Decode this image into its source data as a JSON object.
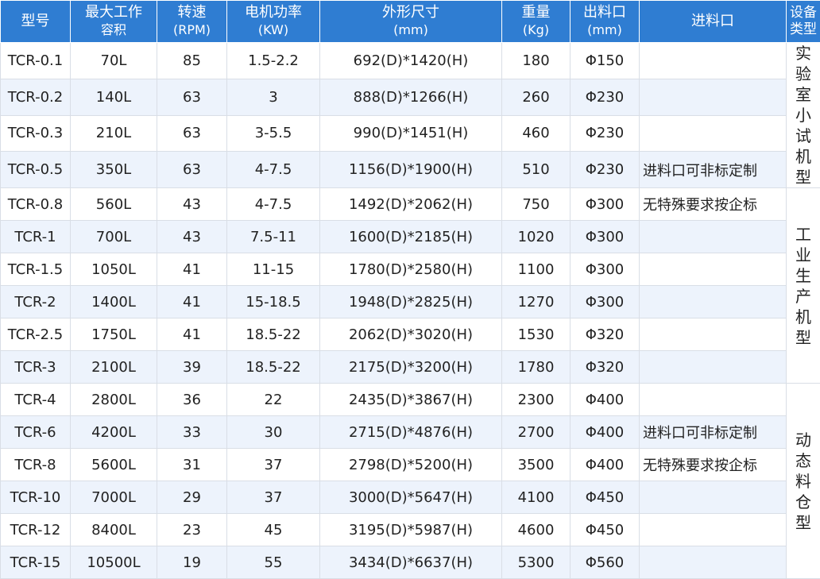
{
  "headers": {
    "model": "型号",
    "capacity_line1": "最大工作",
    "capacity_line2": "容积",
    "speed_line1": "转速",
    "speed_line2": "(RPM)",
    "power_line1": "电机功率",
    "power_line2": "(KW)",
    "dims_line1": "外形尺寸",
    "dims_line2": "(mm)",
    "weight_line1": "重量",
    "weight_line2": "(Kg)",
    "outlet_line1": "出料口",
    "outlet_line2": "(mm)",
    "inlet": "进料口",
    "type_line1": "设备",
    "type_line2": "类型"
  },
  "rows": [
    {
      "model": "TCR-0.1",
      "capacity": "70L",
      "speed": "85",
      "power": "1.5-2.2",
      "dims": "692(D)*1420(H)",
      "weight": "180",
      "outlet": "Φ150",
      "inlet": ""
    },
    {
      "model": "TCR-0.2",
      "capacity": "140L",
      "speed": "63",
      "power": "3",
      "dims": "888(D)*1266(H)",
      "weight": "260",
      "outlet": "Φ230",
      "inlet": ""
    },
    {
      "model": "TCR-0.3",
      "capacity": "210L",
      "speed": "63",
      "power": "3-5.5",
      "dims": "990(D)*1451(H)",
      "weight": "460",
      "outlet": "Φ230",
      "inlet": ""
    },
    {
      "model": "TCR-0.5",
      "capacity": "350L",
      "speed": "63",
      "power": "4-7.5",
      "dims": "1156(D)*1900(H)",
      "weight": "510",
      "outlet": "Φ230",
      "inlet": "进料口可非标定制"
    },
    {
      "model": "TCR-0.8",
      "capacity": "560L",
      "speed": "43",
      "power": "4-7.5",
      "dims": "1492(D)*2062(H)",
      "weight": "750",
      "outlet": "Φ300",
      "inlet": "无特殊要求按企标"
    },
    {
      "model": "TCR-1",
      "capacity": "700L",
      "speed": "43",
      "power": "7.5-11",
      "dims": "1600(D)*2185(H)",
      "weight": "1020",
      "outlet": "Φ300",
      "inlet": ""
    },
    {
      "model": "TCR-1.5",
      "capacity": "1050L",
      "speed": "41",
      "power": "11-15",
      "dims": "1780(D)*2580(H)",
      "weight": "1100",
      "outlet": "Φ300",
      "inlet": ""
    },
    {
      "model": "TCR-2",
      "capacity": "1400L",
      "speed": "41",
      "power": "15-18.5",
      "dims": "1948(D)*2825(H)",
      "weight": "1270",
      "outlet": "Φ300",
      "inlet": ""
    },
    {
      "model": "TCR-2.5",
      "capacity": "1750L",
      "speed": "41",
      "power": "18.5-22",
      "dims": "2062(D)*3020(H)",
      "weight": "1530",
      "outlet": "Φ320",
      "inlet": ""
    },
    {
      "model": "TCR-3",
      "capacity": "2100L",
      "speed": "39",
      "power": "18.5-22",
      "dims": "2175(D)*3200(H)",
      "weight": "1780",
      "outlet": "Φ320",
      "inlet": ""
    },
    {
      "model": "TCR-4",
      "capacity": "2800L",
      "speed": "36",
      "power": "22",
      "dims": "2435(D)*3867(H)",
      "weight": "2300",
      "outlet": "Φ400",
      "inlet": ""
    },
    {
      "model": "TCR-6",
      "capacity": "4200L",
      "speed": "33",
      "power": "30",
      "dims": "2715(D)*4876(H)",
      "weight": "2700",
      "outlet": "Φ400",
      "inlet": "进料口可非标定制"
    },
    {
      "model": "TCR-8",
      "capacity": "5600L",
      "speed": "31",
      "power": "37",
      "dims": "2798(D)*5200(H)",
      "weight": "3500",
      "outlet": "Φ400",
      "inlet": "无特殊要求按企标"
    },
    {
      "model": "TCR-10",
      "capacity": "7000L",
      "speed": "29",
      "power": "37",
      "dims": "3000(D)*5647(H)",
      "weight": "4100",
      "outlet": "Φ450",
      "inlet": ""
    },
    {
      "model": "TCR-12",
      "capacity": "8400L",
      "speed": "23",
      "power": "45",
      "dims": "3195(D)*5987(H)",
      "weight": "4600",
      "outlet": "Φ450",
      "inlet": ""
    },
    {
      "model": "TCR-15",
      "capacity": "10500L",
      "speed": "19",
      "power": "55",
      "dims": "3434(D)*6637(H)",
      "weight": "5300",
      "outlet": "Φ560",
      "inlet": ""
    }
  ],
  "groups": [
    {
      "lines": [
        "实验",
        "室小",
        "试机",
        "型"
      ]
    },
    {
      "lines": [
        "工业",
        "生产",
        "机型"
      ]
    },
    {
      "lines": [
        "动态",
        "料仓",
        "型"
      ]
    }
  ],
  "colors": {
    "header_bg": "#2f7dd2",
    "alt_row_bg": "#edf3fc"
  }
}
